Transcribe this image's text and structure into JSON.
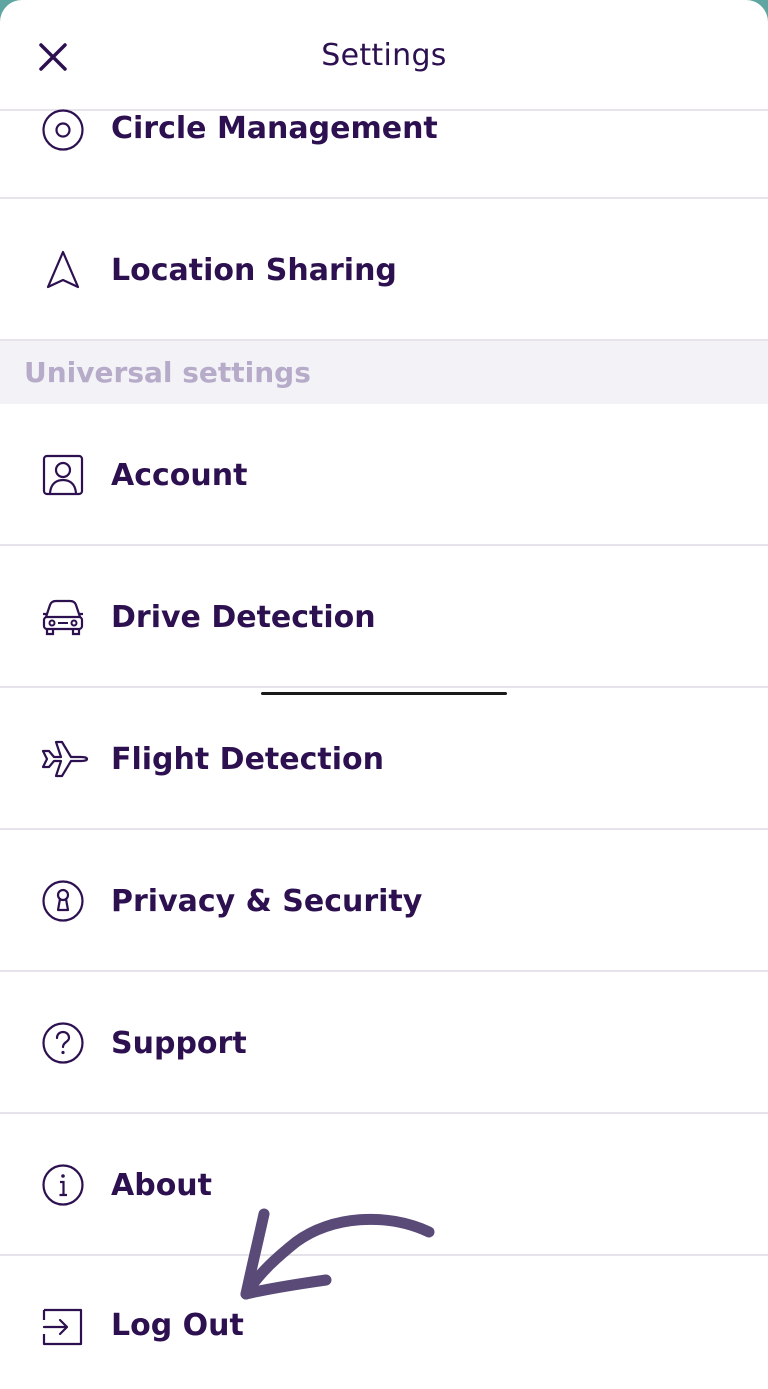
{
  "header": {
    "title": "Settings"
  },
  "section": {
    "universal_label": "Universal settings"
  },
  "rows": {
    "circle_management": "Circle Management",
    "location_sharing": "Location Sharing",
    "account": "Account",
    "drive_detection": "Drive Detection",
    "flight_detection": "Flight Detection",
    "privacy_security": "Privacy & Security",
    "support": "Support",
    "about": "About",
    "log_out": "Log Out"
  },
  "icons": {
    "close": "close-icon",
    "circle_management": "target-circle-icon",
    "location_sharing": "navigation-arrow-icon",
    "account": "person-card-icon",
    "drive_detection": "car-icon",
    "flight_detection": "airplane-icon",
    "privacy_security": "keyhole-icon",
    "support": "question-icon",
    "about": "info-icon",
    "log_out": "logout-icon"
  },
  "colors": {
    "text": "#2d1050",
    "section_text": "#b7abca",
    "section_bg": "#f3f2f6",
    "divider": "#e6e4ea",
    "annotation": "#5a4a78"
  }
}
